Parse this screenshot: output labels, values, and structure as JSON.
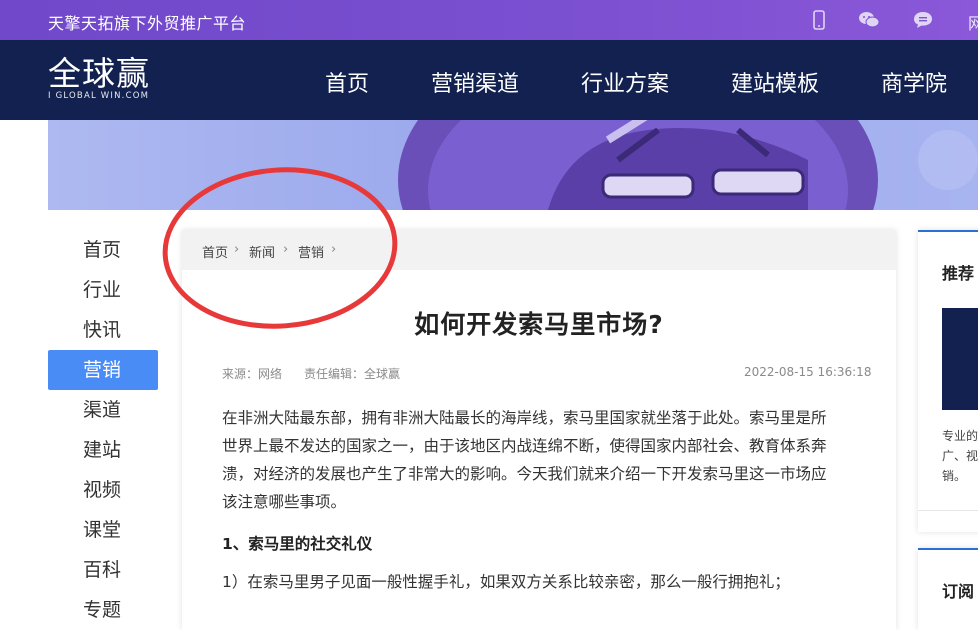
{
  "topbar": {
    "slogan": "天擎天拓旗下外贸推广平台",
    "more": "网",
    "icons": [
      "phone-icon",
      "wechat-icon",
      "chat-icon"
    ]
  },
  "header": {
    "logo_name": "全球赢",
    "logo_sub": "I GLOBAL WIN.COM",
    "nav": [
      "首页",
      "营销渠道",
      "行业方案",
      "建站模板",
      "商学院"
    ]
  },
  "leftmenu": {
    "items": [
      "首页",
      "行业",
      "快讯",
      "营销",
      "渠道",
      "建站",
      "视频",
      "课堂",
      "百科",
      "专题"
    ],
    "active_index": 3
  },
  "breadcrumb": [
    "首页",
    "新闻",
    "营销"
  ],
  "article": {
    "title": "如何开发索马里市场?",
    "source": "来源：网络",
    "editor": "责任编辑：全球赢",
    "datetime": "2022-08-15 16:36:18",
    "para1_lines": [
      "在非洲大陆最东部，拥有非洲大陆最长的海岸线，索马里国家就坐落于此处。索马里是所",
      "世界上最不发达的国家之一，由于该地区内战连绵不断，使得国家内部社会、教育体系奔",
      "溃，对经济的发展也产生了非常大的影响。今天我们就来介绍一下开发索马里这一市场应",
      "该注意哪些事项。"
    ],
    "heading1": "1、索马里的社交礼仪",
    "para2": "1）在索马里男子见面一般性握手礼，如果双方关系比较亲密，那么一般行拥抱礼；"
  },
  "rightcol": {
    "title": "推荐",
    "text_lines": [
      "专业的",
      "广、视",
      "销。"
    ],
    "title2": "订阅"
  },
  "colors": {
    "topbar": "#7048c9",
    "header": "#12214f",
    "active_menu": "#4a8cf5",
    "annotation": "#e8393a"
  }
}
